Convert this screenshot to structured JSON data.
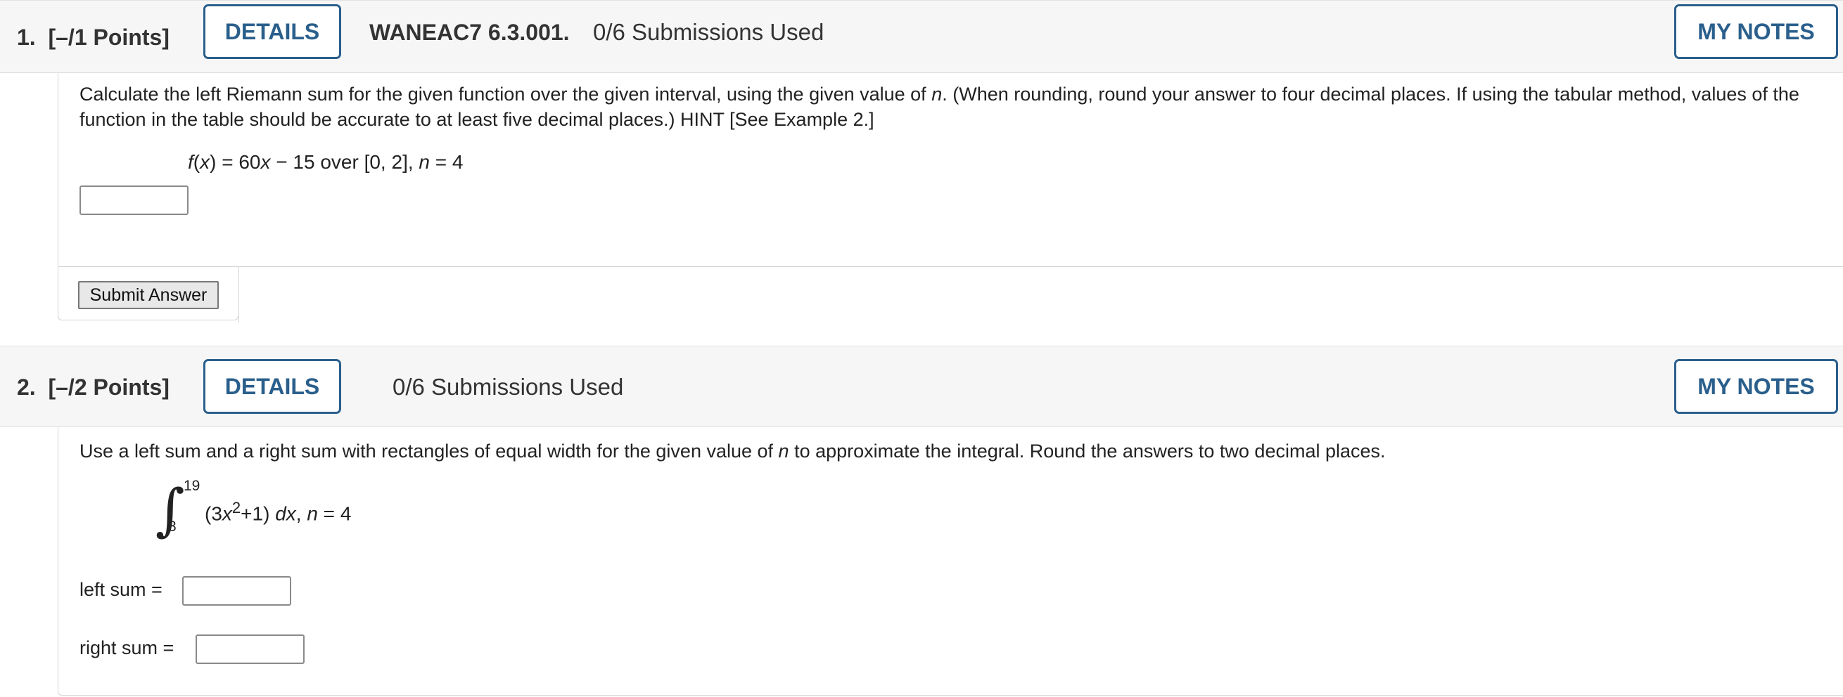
{
  "questions": [
    {
      "number": "1.",
      "points": "[–/1 Points]",
      "details_label": "DETAILS",
      "assignment_id": "WANEAC7 6.3.001.",
      "submissions": "0/6 Submissions Used",
      "notes_label": "MY NOTES",
      "prompt_pre": "Calculate the left Riemann sum for the given function over the given interval, using the given value of ",
      "prompt_var": "n",
      "prompt_post": ". (When rounding, round your answer to four decimal places. If using the tabular method, values of the function in the table should be accurate to at least five decimal places.) HINT [See Example 2.]",
      "math_f": "f",
      "math_x1": "x",
      "math_mid1": ") = 60",
      "math_x2": "x",
      "math_mid2": " − 15 over [0, 2], ",
      "math_n": "n",
      "math_end": " = 4",
      "answer_value": "",
      "submit_label": "Submit Answer"
    },
    {
      "number": "2.",
      "points": "[–/2 Points]",
      "details_label": "DETAILS",
      "submissions": "0/6 Submissions Used",
      "notes_label": "MY NOTES",
      "prompt_pre": "Use a left sum and a right sum with rectangles of equal width for the given value of ",
      "prompt_var": "n",
      "prompt_post": " to approximate the integral. Round the answers to two decimal places.",
      "integral_upper": "19",
      "integral_lower": "3",
      "integrand_open": "(3",
      "integrand_x": "x",
      "integrand_exp": "2",
      "integrand_rest": "+1) ",
      "integrand_dx": "dx",
      "integrand_comma": ", ",
      "integrand_n": "n",
      "integrand_end": " = 4",
      "left_sum_label": "left sum =",
      "right_sum_label": "right sum =",
      "left_sum_value": "",
      "right_sum_value": ""
    }
  ],
  "colors": {
    "accent": "#2a5f8c",
    "header_bg": "#f6f6f6"
  }
}
